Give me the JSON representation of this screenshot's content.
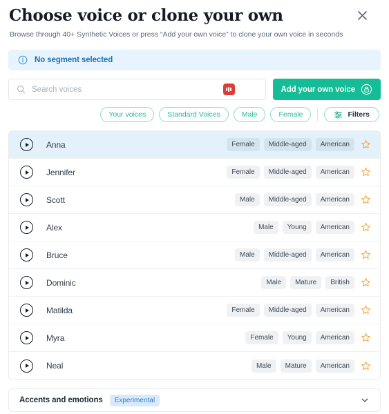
{
  "header": {
    "title": "Choose voice or clone your own",
    "subtitle": "Browse through 40+ Synthetic Voices or press “Add your own voice” to clone your own voice in seconds",
    "close_icon": "close-icon"
  },
  "banner": {
    "icon": "info-circle-icon",
    "text": "No segment selected",
    "bg_color": "#e8f4fd",
    "text_color": "#1a6fb5"
  },
  "search": {
    "icon": "search-icon",
    "placeholder": "Search voices",
    "value": "",
    "record_icon": "record-waveform-icon",
    "record_color": "#e03c36"
  },
  "add_voice_button": {
    "label": "Add your own voice",
    "icon": "lock-circle-icon",
    "bg_color": "#15bd96"
  },
  "filter_chips": [
    {
      "label": "Your voices",
      "name": "chip-your-voices"
    },
    {
      "label": "Standard Voices",
      "name": "chip-standard-voices"
    },
    {
      "label": "Male",
      "name": "chip-male"
    },
    {
      "label": "Female",
      "name": "chip-female"
    }
  ],
  "filters_button": {
    "label": "Filters",
    "icon": "sliders-icon"
  },
  "voices": [
    {
      "name": "Anna",
      "gender": "Female",
      "age": "Middle-aged",
      "accent": "American",
      "selected": true,
      "favorite": false
    },
    {
      "name": "Jennifer",
      "gender": "Female",
      "age": "Middle-aged",
      "accent": "American",
      "selected": false,
      "favorite": false
    },
    {
      "name": "Scott",
      "gender": "Male",
      "age": "Middle-aged",
      "accent": "American",
      "selected": false,
      "favorite": false
    },
    {
      "name": "Alex",
      "gender": "Male",
      "age": "Young",
      "accent": "American",
      "selected": false,
      "favorite": false
    },
    {
      "name": "Bruce",
      "gender": "Male",
      "age": "Middle-aged",
      "accent": "American",
      "selected": false,
      "favorite": false
    },
    {
      "name": "Dominic",
      "gender": "Male",
      "age": "Mature",
      "accent": "British",
      "selected": false,
      "favorite": false
    },
    {
      "name": "Matilda",
      "gender": "Female",
      "age": "Middle-aged",
      "accent": "American",
      "selected": false,
      "favorite": false
    },
    {
      "name": "Myra",
      "gender": "Female",
      "age": "Young",
      "accent": "American",
      "selected": false,
      "favorite": false
    },
    {
      "name": "Neal",
      "gender": "Male",
      "age": "Mature",
      "accent": "American",
      "selected": false,
      "favorite": false
    }
  ],
  "accordion": {
    "title": "Accents and emotions",
    "badge": "Experimental",
    "chevron_icon": "chevron-down-icon",
    "expanded": false
  },
  "colors": {
    "accent": "#15bd96",
    "info": "#1a6fb5",
    "selected_row": "#e3f1fb",
    "star": "#f2a33c",
    "record": "#e03c36"
  }
}
